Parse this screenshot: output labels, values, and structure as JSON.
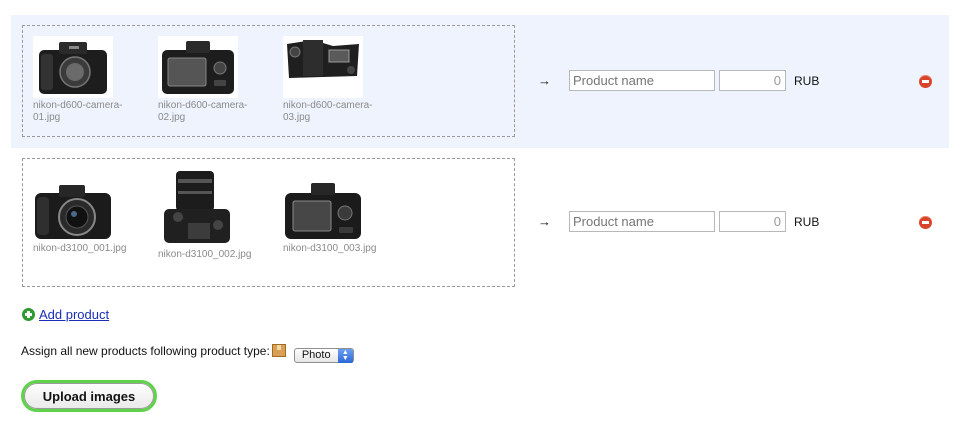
{
  "rows": [
    {
      "images": [
        {
          "filename": "nikon-d600-camera-01.jpg",
          "icon": "camera-front-body-icon"
        },
        {
          "filename": "nikon-d600-camera-02.jpg",
          "icon": "camera-back-icon"
        },
        {
          "filename": "nikon-d600-camera-03.jpg",
          "icon": "camera-top-icon"
        }
      ],
      "arrow": "→",
      "name_placeholder": "Product name",
      "price_value": "0",
      "currency": "RUB"
    },
    {
      "images": [
        {
          "filename": "nikon-d3100_001.jpg",
          "icon": "camera-front-lens-icon"
        },
        {
          "filename": "nikon-d3100_002.jpg",
          "icon": "camera-side-lens-icon"
        },
        {
          "filename": "nikon-d3100_003.jpg",
          "icon": "camera-back-icon"
        }
      ],
      "arrow": "→",
      "name_placeholder": "Product name",
      "price_value": "0",
      "currency": "RUB"
    }
  ],
  "add_product_label": "Add product",
  "assign_label": "Assign all new products following product type:",
  "product_type_selected": "Photo",
  "upload_button_label": "Upload images",
  "colors": {
    "highlight_row": "#eef3fd",
    "remove_icon": "#d8432b",
    "add_icon": "#2f9a2f",
    "upload_focus_ring": "#5fd34a",
    "link": "#1a2fb5"
  }
}
